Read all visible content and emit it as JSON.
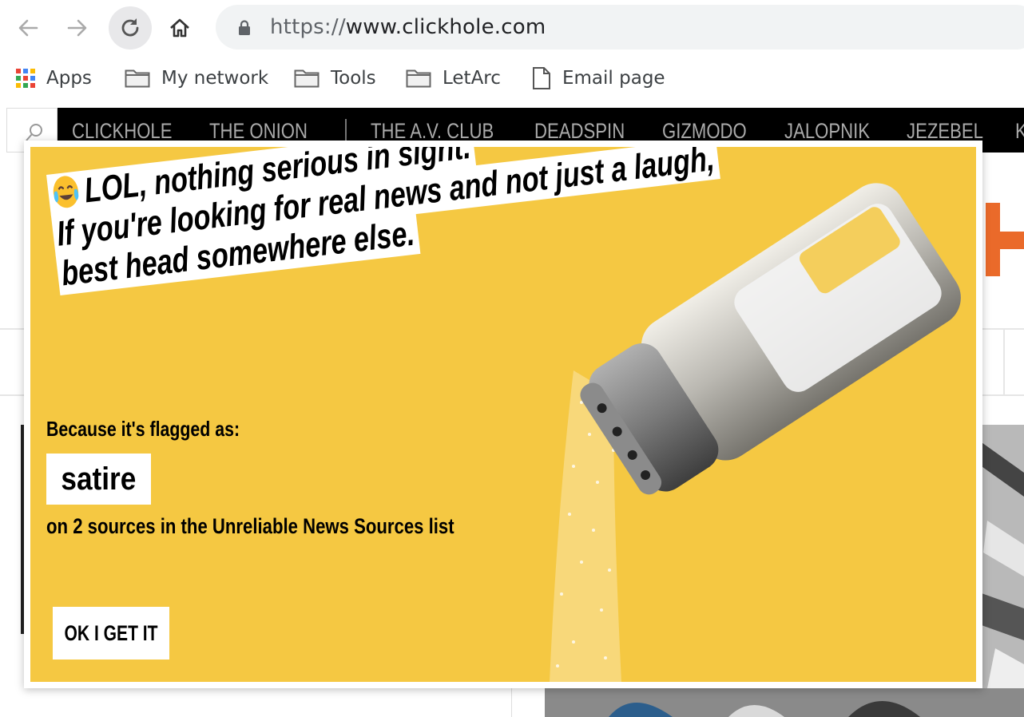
{
  "browser": {
    "url_scheme": "https://",
    "url_host": "www.clickhole.com"
  },
  "bookmarks": [
    {
      "label": "Apps",
      "icon": "apps-grid-icon"
    },
    {
      "label": "My network",
      "icon": "folder-icon"
    },
    {
      "label": "Tools",
      "icon": "folder-icon"
    },
    {
      "label": "LetArc",
      "icon": "folder-icon"
    },
    {
      "label": "Email page",
      "icon": "page-icon"
    }
  ],
  "site_nav": {
    "links": [
      "CLICKHOLE",
      "THE ONION",
      "THE A.V. CLUB",
      "DEADSPIN",
      "GIZMODO",
      "JALOPNIK",
      "JEZEBEL",
      "K"
    ]
  },
  "modal": {
    "headline_lines": [
      "LOL, nothing serious in sight.",
      "If you're looking for real news and not just a laugh,",
      "best head somewhere else."
    ],
    "flag_label": "Because it's flagged as:",
    "flag_value": "satire",
    "sources_text": "on 2 sources in the Unreliable News Sources list",
    "ok_button": "OK I GET IT"
  },
  "colors": {
    "modal_yellow": "#f5c842",
    "nav_black": "#000000",
    "nav_link": "#ababab",
    "brand_orange": "#ea6a2a"
  }
}
